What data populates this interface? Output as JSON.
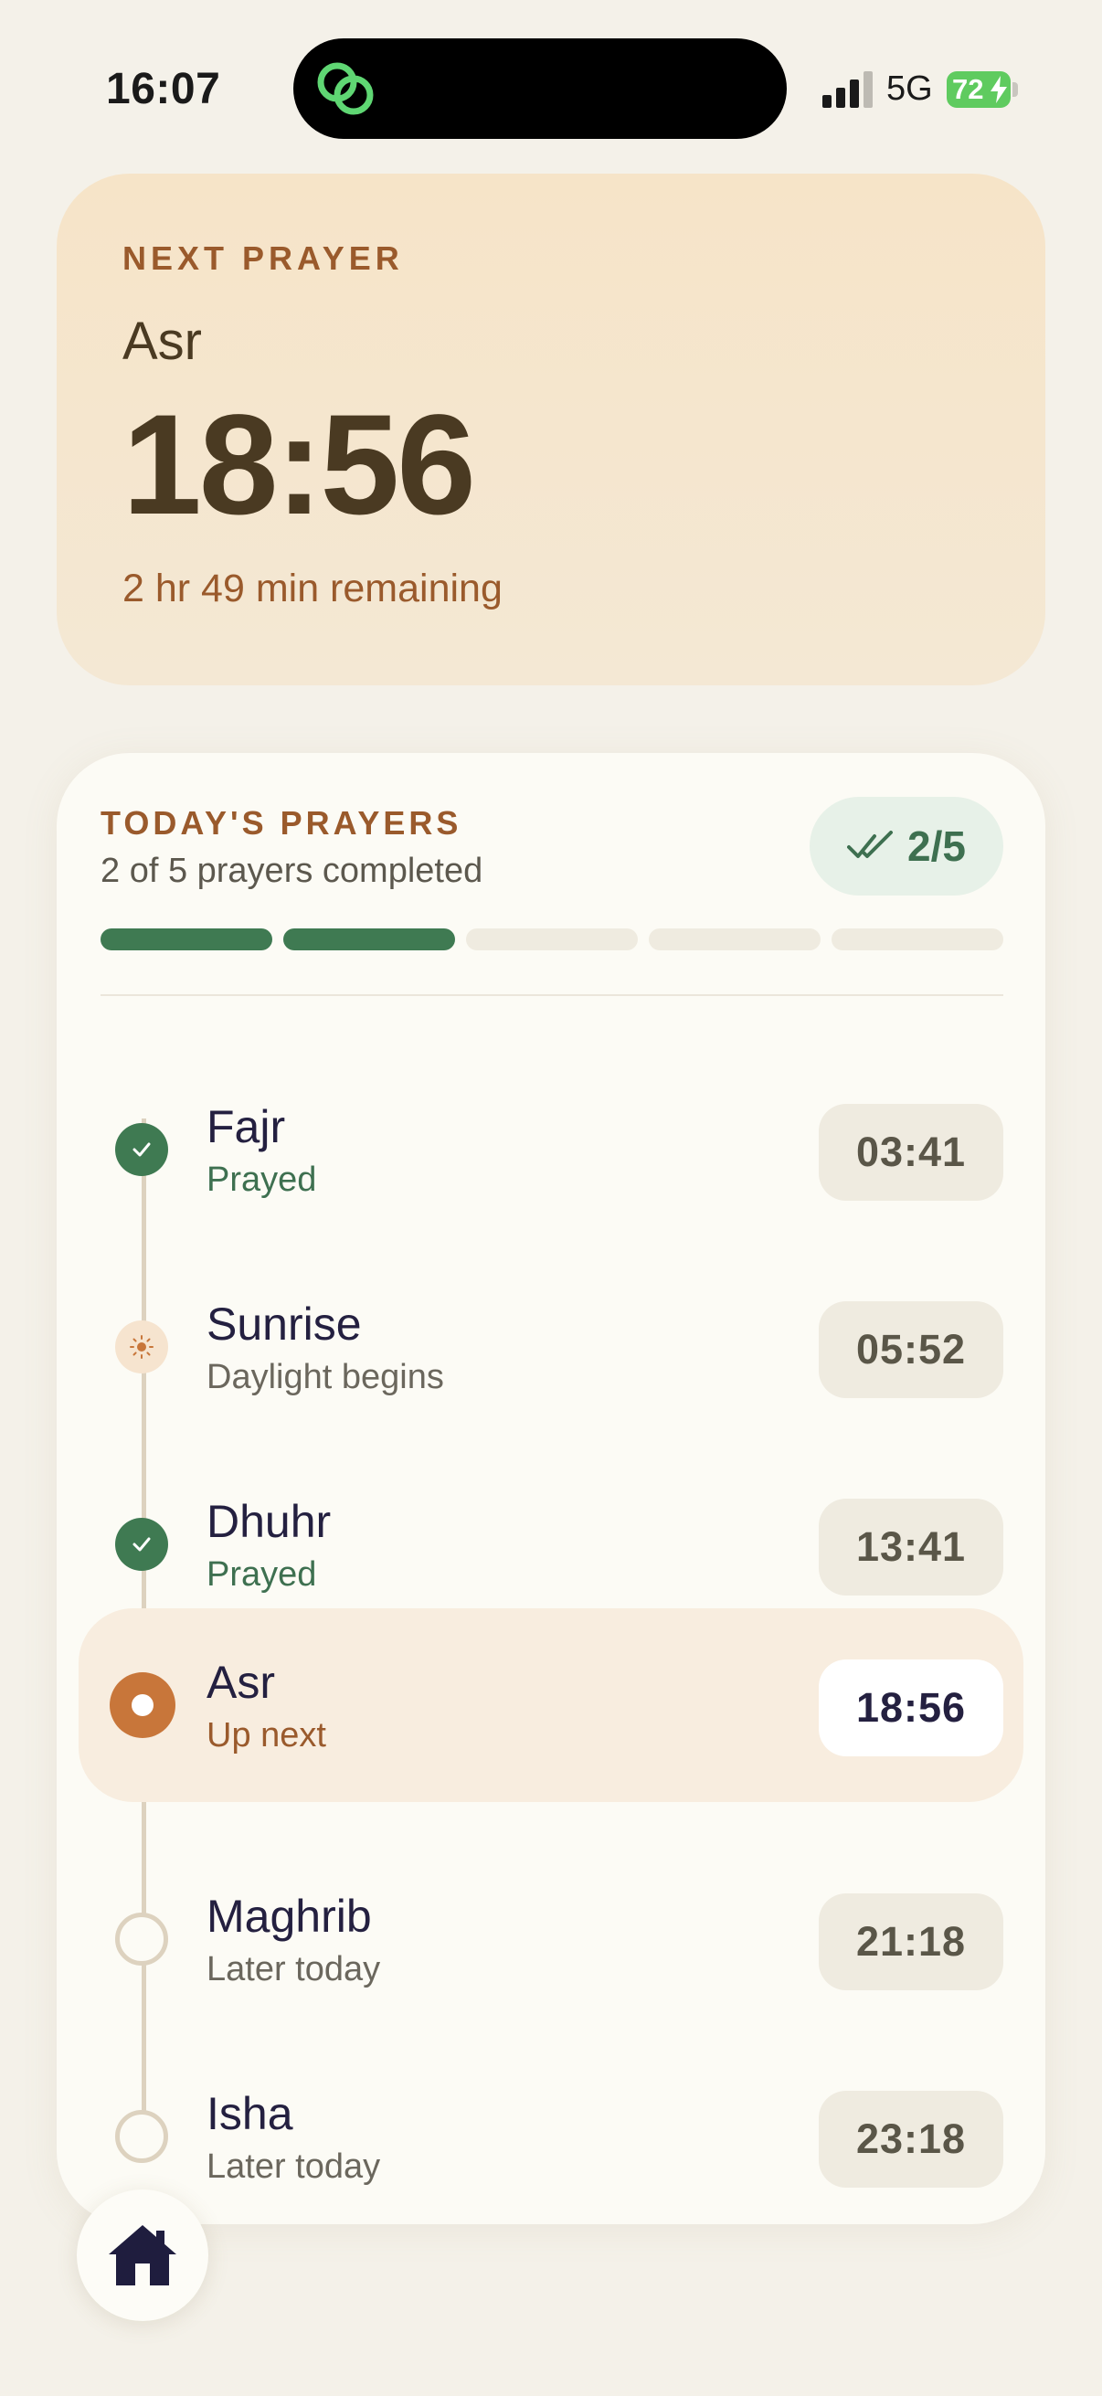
{
  "status_bar": {
    "time": "16:07",
    "network": "5G",
    "battery": "72"
  },
  "next_prayer": {
    "label": "NEXT PRAYER",
    "name": "Asr",
    "time": "18:56",
    "remaining": "2 hr 49 min remaining"
  },
  "today": {
    "label": "TODAY'S PRAYERS",
    "summary": "2 of 5 prayers completed",
    "count": "2/5",
    "progress_completed": 2,
    "progress_total": 5,
    "prayers": [
      {
        "name": "Fajr",
        "status": "Prayed",
        "time": "03:41",
        "state": "done"
      },
      {
        "name": "Sunrise",
        "status": "Daylight begins",
        "time": "05:52",
        "state": "sunrise"
      },
      {
        "name": "Dhuhr",
        "status": "Prayed",
        "time": "13:41",
        "state": "done"
      },
      {
        "name": "Asr",
        "status": "Up next",
        "time": "18:56",
        "state": "current"
      },
      {
        "name": "Maghrib",
        "status": "Later today",
        "time": "21:18",
        "state": "upcoming"
      },
      {
        "name": "Isha",
        "status": "Later today",
        "time": "23:18",
        "state": "upcoming"
      }
    ]
  },
  "colors": {
    "accent_green": "#3f7a52",
    "accent_orange": "#c8763a",
    "label_brown": "#9a5a2c"
  },
  "icons": {
    "island": "link-rings-icon",
    "home": "home-icon",
    "check": "check-icon",
    "sun": "sun-icon",
    "double_check": "double-check-icon"
  }
}
